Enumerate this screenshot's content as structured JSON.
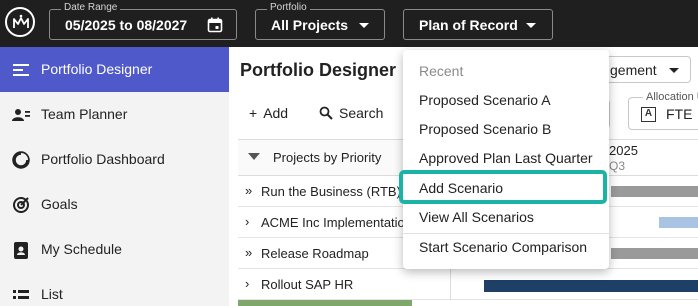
{
  "colors": {
    "topbar": "#1f1f1f",
    "sidebar_active": "#5059c9",
    "menu_highlight": "#1ab3a6",
    "bar_gray": "#9a9a9a",
    "bar_light_blue": "#a9c4e3",
    "bar_navy": "#1e3f66",
    "row_green": "#7fa66b"
  },
  "topbar": {
    "logo_icon": "mountain-logo-icon",
    "date_range": {
      "label": "Date Range",
      "value": "05/2025 to 08/2027",
      "icon": "calendar-icon"
    },
    "portfolio": {
      "label": "Portfolio",
      "value": "All Projects"
    },
    "plan": {
      "value": "Plan of Record"
    }
  },
  "sidebar": {
    "items": [
      {
        "label": "Portfolio Designer",
        "icon": "sliders-icon",
        "active": true
      },
      {
        "label": "Team Planner",
        "icon": "people-icon"
      },
      {
        "label": "Portfolio Dashboard",
        "icon": "pie-chart-icon"
      },
      {
        "label": "Goals",
        "icon": "target-icon"
      },
      {
        "label": "My Schedule",
        "icon": "contact-badge-icon"
      },
      {
        "label": "List",
        "icon": "list-icon"
      }
    ]
  },
  "main": {
    "title": "Portfolio Designer",
    "view_select": "gement",
    "toolbar": {
      "add_label": "Add",
      "search_label": "Search"
    },
    "allocation": {
      "label": "Allocation U",
      "value": "FTE"
    },
    "list_header": "Projects by Priority",
    "timeline": {
      "year": "2025",
      "quarter": "Q3"
    },
    "rows": [
      {
        "glyph": "»",
        "label": "Run the Business (RTB)"
      },
      {
        "glyph": "›",
        "label": "ACME Inc Implementation"
      },
      {
        "glyph": "»",
        "label": "Release Roadmap"
      },
      {
        "glyph": "›",
        "label": "Rollout SAP HR"
      }
    ]
  },
  "plan_menu": {
    "header": "Recent",
    "items": [
      "Proposed Scenario A",
      "Proposed Scenario B",
      "Approved Plan Last Quarter",
      "Add Scenario",
      "View All Scenarios",
      "Start Scenario Comparison"
    ],
    "highlighted": "Add Scenario"
  }
}
